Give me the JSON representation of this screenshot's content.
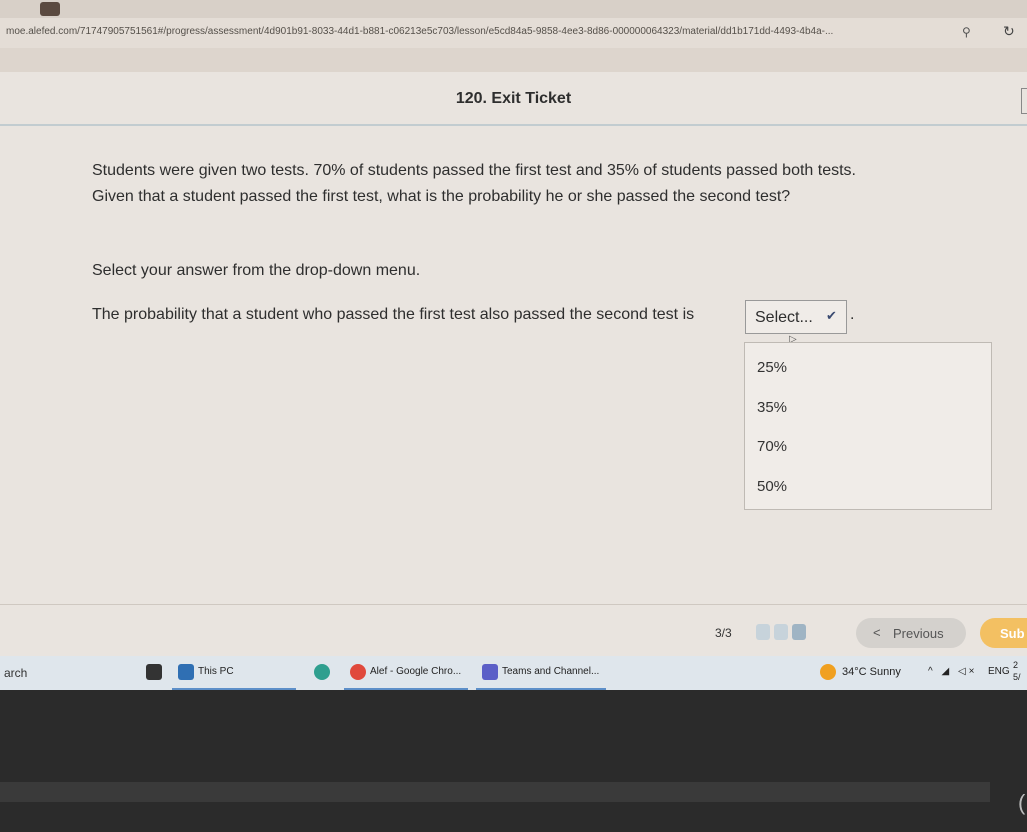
{
  "browser": {
    "url": "moe.alefed.com/71747905751561#/progress/assessment/4d901b91-8033-44d1-b881-c06213e5c703/lesson/e5cd84a5-9858-4ee3-8d86-000000064323/material/dd1b171dd-4493-4b4a-...",
    "location_icon": "location-pin-icon",
    "reload_icon": "reload-icon"
  },
  "header": {
    "title": "120. Exit Ticket"
  },
  "question": {
    "text": "Students were given two tests. 70% of students passed the first test and 35% of students passed both tests. Given that a student passed the first test, what is the probability he or she passed the second test?",
    "instruction": "Select your answer from the drop-down menu.",
    "prompt": "The probability that a student who passed the first test also passed the second test is",
    "select_value": "Select...",
    "period": ".",
    "options": [
      "25%",
      "35%",
      "70%",
      "50%"
    ]
  },
  "footer": {
    "count": "3/3",
    "previous_label": "Previous",
    "submit_label": "Sub"
  },
  "taskbar": {
    "search_text": "arch",
    "items": [
      {
        "label": "This PC",
        "icon": "folder-icon",
        "color": "#2f6fb3"
      },
      {
        "label": "Alef - Google Chro...",
        "icon": "chrome-icon",
        "color": "#e0493c"
      },
      {
        "label": "Teams and Channel...",
        "icon": "teams-icon",
        "color": "#5b5fc7"
      }
    ],
    "weather": "34°C  Sunny",
    "lang": "ENG",
    "time": "2",
    "date": "5/"
  },
  "colors": {
    "page_bg": "#e9e4df",
    "submit": "#f3c062",
    "previous": "#d4d1cd",
    "taskbar": "#dfe6ec"
  }
}
